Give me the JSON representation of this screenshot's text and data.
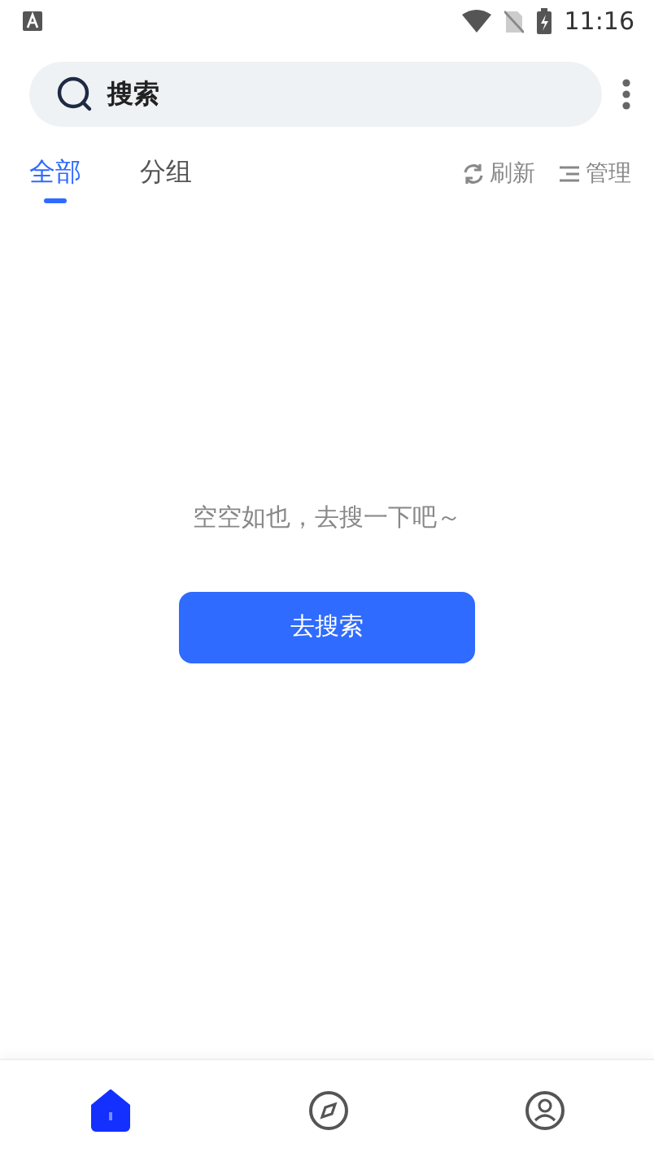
{
  "status_bar": {
    "time": "11:16"
  },
  "search": {
    "placeholder": "搜索"
  },
  "tabs": [
    {
      "label": "全部",
      "selected": true
    },
    {
      "label": "分组",
      "selected": false
    }
  ],
  "actions": [
    {
      "kind": "refresh",
      "label": "刷新"
    },
    {
      "kind": "manage",
      "label": "管理"
    }
  ],
  "empty": {
    "message": "空空如也，去搜一下吧～",
    "button": "去搜索"
  },
  "nav": [
    {
      "kind": "home",
      "selected": true
    },
    {
      "kind": "discover",
      "selected": false
    },
    {
      "kind": "profile",
      "selected": false
    }
  ]
}
